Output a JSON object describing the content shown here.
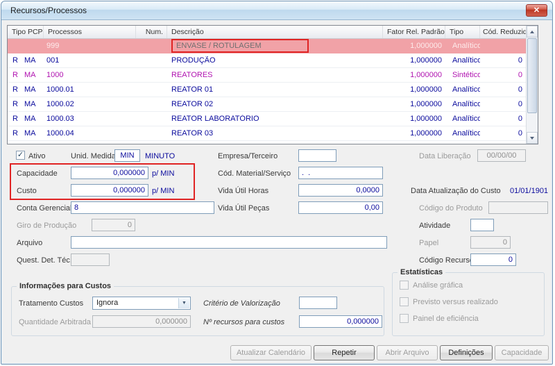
{
  "window": {
    "title": "Recursos/Processos"
  },
  "icons": {
    "check": "✓",
    "combo_arrow": "▼",
    "close": "✕"
  },
  "colors": {
    "selected_row_bg": "#f1a2a7",
    "row_text": "#0b0b9d",
    "sintetico_row_text": "#b012b0",
    "annotation": "#e02424"
  },
  "table": {
    "columns": [
      "Tipo PCP",
      "Processos",
      "Num.",
      "Descrição",
      "Fator Rel. Padrão",
      "Tipo",
      "Cód. Reduzido"
    ],
    "rows": [
      {
        "tipo_pcp": "",
        "ma": "",
        "processos": "999",
        "num": "",
        "descricao": "ENVASE / ROTULAGEM",
        "fator_rel_padrao": "1,000000",
        "tipo": "Analítico",
        "cod_reduzido": "",
        "selected": true,
        "annotated": true
      },
      {
        "tipo_pcp": "R",
        "ma": "MA",
        "processos": "001",
        "num": "",
        "descricao": "PRODUÇÃO",
        "fator_rel_padrao": "1,000000",
        "tipo": "Analítico",
        "cod_reduzido": "0"
      },
      {
        "tipo_pcp": "R",
        "ma": "MA",
        "processos": "1000",
        "num": "",
        "descricao": "REATORES",
        "fator_rel_padrao": "1,000000",
        "tipo": "Sintético",
        "cod_reduzido": "0",
        "text_color": "#b012b0"
      },
      {
        "tipo_pcp": "R",
        "ma": "MA",
        "processos": "1000.01",
        "num": "",
        "descricao": "REATOR 01",
        "fator_rel_padrao": "1,000000",
        "tipo": "Analítico",
        "cod_reduzido": "0"
      },
      {
        "tipo_pcp": "R",
        "ma": "MA",
        "processos": "1000.02",
        "num": "",
        "descricao": "REATOR 02",
        "fator_rel_padrao": "1,000000",
        "tipo": "Analítico",
        "cod_reduzido": "0"
      },
      {
        "tipo_pcp": "R",
        "ma": "MA",
        "processos": "1000.03",
        "num": "",
        "descricao": "REATOR LABORATÓRIO",
        "fator_rel_padrao": "1,000000",
        "tipo": "Analítico",
        "cod_reduzido": "0"
      },
      {
        "tipo_pcp": "R",
        "ma": "MA",
        "processos": "1000.04",
        "num": "",
        "descricao": "REATOR 03",
        "fator_rel_padrao": "1,000000",
        "tipo": "Analítico",
        "cod_reduzido": "0"
      }
    ]
  },
  "form": {
    "ativo": {
      "label": "Ativo",
      "checked": true
    },
    "unid_medida": {
      "label": "Unid. Medida",
      "value": "MIN",
      "description": "MINUTO"
    },
    "empresa_terceiro": {
      "label": "Empresa/Terceiro",
      "value": ""
    },
    "data_liberacao": {
      "label": "Data Liberação",
      "value": "00/00/00"
    },
    "capacidade": {
      "label": "Capacidade",
      "value": "0,000000",
      "unit": "p/ MIN"
    },
    "cod_material_servico": {
      "label": "Cód. Material/Serviço",
      "value": ".  ."
    },
    "custo": {
      "label": "Custo",
      "value": "0,000000",
      "unit": "p/ MIN"
    },
    "vida_util_horas": {
      "label": "Vida Útil Horas",
      "value": "0,0000"
    },
    "data_atualizacao_custo": {
      "label": "Data Atualização do Custo",
      "value": "01/01/1901"
    },
    "conta_gerencial": {
      "label": "Conta Gerencial",
      "value": "8"
    },
    "vida_util_pecas": {
      "label": "Vida Útil Peças",
      "value": "0,00"
    },
    "codigo_produto": {
      "label": "Código do Produto",
      "value": ""
    },
    "giro_producao": {
      "label": "Giro de Produção",
      "value": "0"
    },
    "atividade": {
      "label": "Atividade",
      "value": ""
    },
    "arquivo": {
      "label": "Arquivo",
      "value": ""
    },
    "papel": {
      "label": "Papel",
      "value": "0"
    },
    "quest_det_tec": {
      "label": "Quest. Det. Téc.",
      "value": ""
    },
    "codigo_recurso": {
      "label": "Código Recurso",
      "value": "0"
    }
  },
  "estatisticas": {
    "title": "Estatísticas",
    "items": [
      {
        "label": "Análise gráfica",
        "checked": false
      },
      {
        "label": "Previsto versus realizado",
        "checked": false
      },
      {
        "label": "Painel de eficiência",
        "checked": false
      }
    ]
  },
  "informacoes_custos": {
    "title": "Informações para Custos",
    "tratamento_custos": {
      "label": "Tratamento Custos",
      "value": "Ignora"
    },
    "criterio_valorizacao": {
      "label": "Critério de Valorização",
      "value": ""
    },
    "quantidade_arbitrada": {
      "label": "Quantidade Arbitrada",
      "value": "0,000000"
    },
    "n_recursos_custos": {
      "label": "Nº recursos para custos",
      "value": "0,000000"
    }
  },
  "buttons": [
    {
      "label": "Atualizar Calendário",
      "enabled": false
    },
    {
      "label": "Repetir",
      "enabled": true
    },
    {
      "label": "Abrir Arquivo",
      "enabled": false
    },
    {
      "label": "Definições",
      "enabled": true
    },
    {
      "label": "Capacidade",
      "enabled": false
    }
  ]
}
